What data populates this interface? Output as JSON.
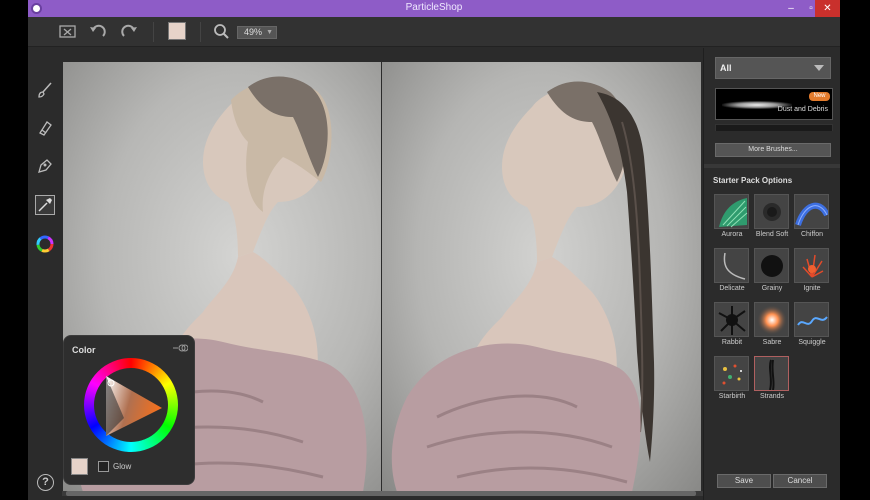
{
  "window": {
    "title": "ParticleShop",
    "min": "–",
    "max": "▫",
    "close": "✕"
  },
  "toolbar": {
    "zoom": "49%"
  },
  "right_panel": {
    "category": "All",
    "featured_brush": {
      "name": "Dust and Debris",
      "badge": "New"
    },
    "more_brushes_label": "More Brushes...",
    "pack_title": "Starter Pack Options",
    "brushes": [
      {
        "label": "Aurora",
        "icon": "aurora-icon"
      },
      {
        "label": "Blend Soft",
        "icon": "blend-soft-icon"
      },
      {
        "label": "Chiffon",
        "icon": "chiffon-icon"
      },
      {
        "label": "Delicate",
        "icon": "delicate-icon"
      },
      {
        "label": "Grainy",
        "icon": "grainy-icon"
      },
      {
        "label": "Ignite",
        "icon": "ignite-icon"
      },
      {
        "label": "Rabbit",
        "icon": "rabbit-icon"
      },
      {
        "label": "Sabre",
        "icon": "sabre-icon"
      },
      {
        "label": "Squiggle",
        "icon": "squiggle-icon"
      },
      {
        "label": "Starbirth",
        "icon": "starbirth-icon"
      },
      {
        "label": "Strands",
        "icon": "strands-icon"
      }
    ],
    "selected_brush": "Strands",
    "save_label": "Save",
    "cancel_label": "Cancel"
  },
  "color_panel": {
    "title": "Color",
    "glow_label": "Glow",
    "current_color": "#e6d3c9"
  },
  "help_label": "?",
  "colors": {
    "title_bar": "#8e5cc7",
    "close_button": "#c9302c",
    "new_badge": "#e37b2c"
  }
}
